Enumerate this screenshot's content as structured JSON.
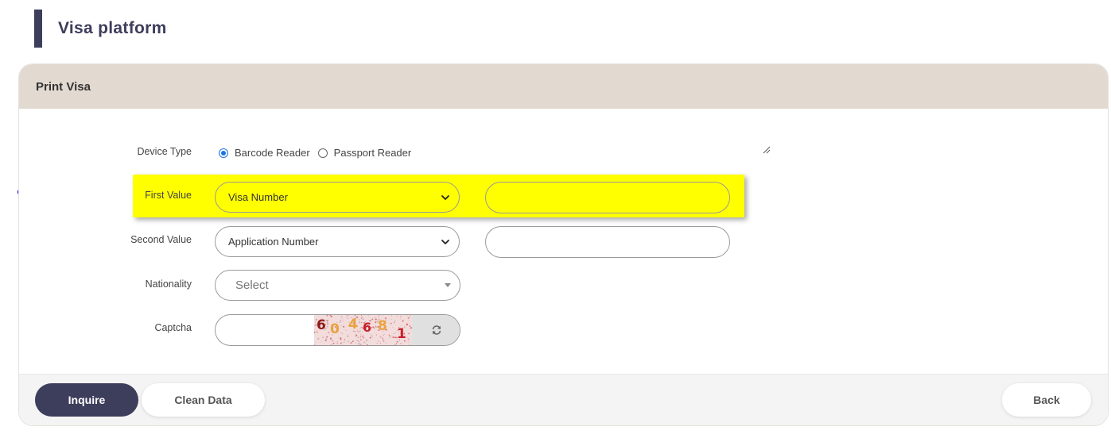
{
  "page": {
    "title": "Visa platform"
  },
  "card": {
    "title": "Print Visa"
  },
  "form": {
    "device_type": {
      "label": "Device Type",
      "options": [
        {
          "label": "Barcode Reader",
          "checked": true
        },
        {
          "label": "Passport Reader",
          "checked": false
        }
      ]
    },
    "first_value": {
      "label": "First Value",
      "selected": "Visa Number",
      "input_value": ""
    },
    "second_value": {
      "label": "Second Value",
      "selected": "Application Number",
      "input_value": ""
    },
    "nationality": {
      "label": "Nationality",
      "placeholder": "Select"
    },
    "captcha": {
      "label": "Captcha",
      "input_value": "",
      "code_chars": [
        "6",
        "0",
        "4",
        "6",
        "8",
        "1"
      ]
    }
  },
  "buttons": {
    "inquire": "Inquire",
    "clean_data": "Clean Data",
    "back": "Back"
  },
  "icons": {
    "select_chevron": "chevron-down-icon",
    "refresh": "refresh-icon",
    "arrow": "arrow-right-icon",
    "resize": "resize-grip-icon"
  },
  "colors": {
    "accent": "#3d3d5c",
    "card_header": "#e2d9d1",
    "highlight": "#ffff00",
    "arrow": "#0a14e6",
    "radio_checked": "#1a73e8",
    "captcha_colors": [
      "#8b1a1a",
      "#e8a33d",
      "#e8a33d",
      "#c8202a",
      "#e8a33d",
      "#c8202a"
    ]
  }
}
